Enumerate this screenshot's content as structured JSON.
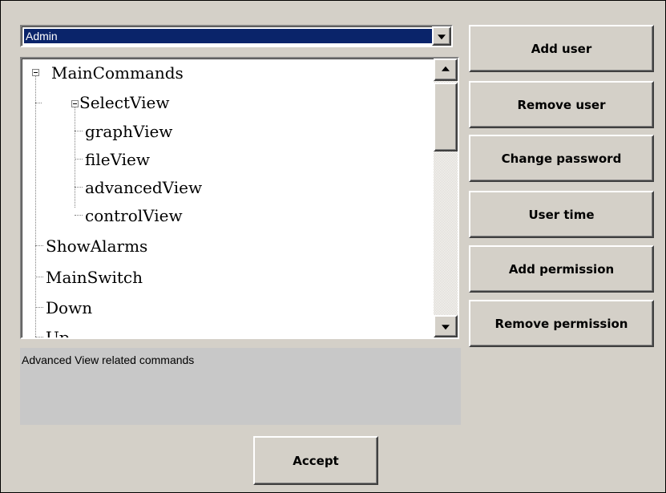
{
  "user_select": {
    "selected": "Admin"
  },
  "tree": {
    "nodes": [
      {
        "label": "MainCommands",
        "expander": "minus"
      },
      {
        "label": "SelectView",
        "expander": "minus"
      },
      {
        "label": "graphView"
      },
      {
        "label": "fileView"
      },
      {
        "label": "advancedView"
      },
      {
        "label": "controlView"
      },
      {
        "label": "ShowAlarms"
      },
      {
        "label": "MainSwitch"
      },
      {
        "label": "Down"
      },
      {
        "label": "Up"
      }
    ]
  },
  "description": "Advanced View related commands",
  "buttons": {
    "add_user": "Add user",
    "remove_user": "Remove user",
    "change_password": "Change password",
    "user_time": "User time",
    "add_permission": "Add permission",
    "remove_permission": "Remove permission",
    "accept": "Accept"
  },
  "colors": {
    "selection": "#0a246a",
    "face": "#d4d0c8",
    "description_bg": "#c8c8c8"
  }
}
